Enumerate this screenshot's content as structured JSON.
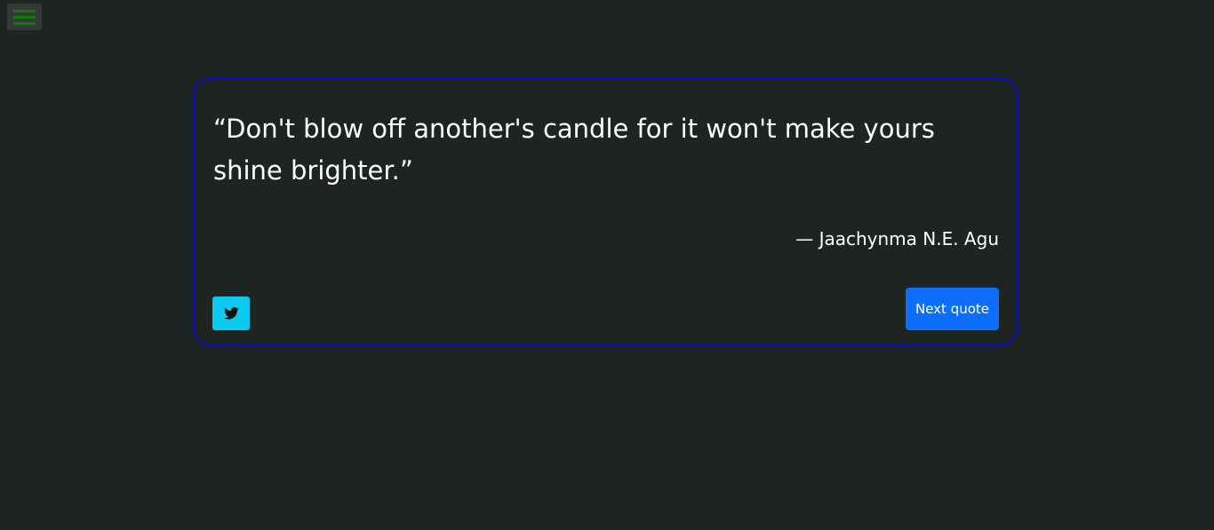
{
  "menu": {
    "icon": "hamburger-menu-icon",
    "color": "#0a7d0a"
  },
  "quote": {
    "text": "“Don't blow off another's candle for it won't make yours shine brighter.”",
    "author": "— Jaachynma N.E. Agu",
    "border_color": "#0d0cc8"
  },
  "actions": {
    "tweet_icon": "twitter-icon",
    "tweet_color": "#0dcaf0",
    "next_label": "Next quote",
    "next_color": "#0d6efd"
  }
}
